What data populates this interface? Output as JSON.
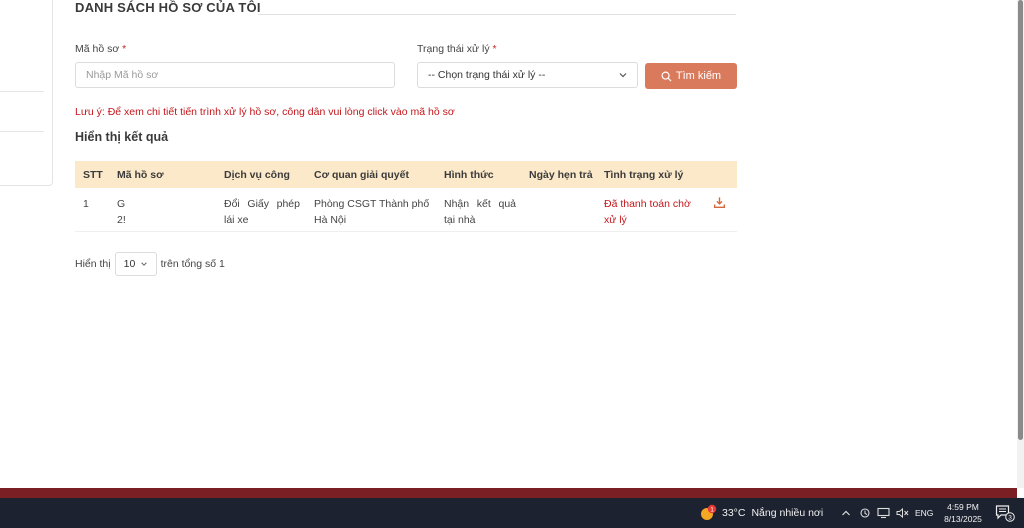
{
  "page": {
    "section_title": "DANH SÁCH HỒ SƠ CỦA TÔI",
    "note": "Lưu ý: Để xem chi tiết tiến trình xử lý hồ sơ, công dân vui lòng click vào mã hồ sơ",
    "results_title": "Hiển thị kết quả"
  },
  "search": {
    "code_label": "Mã hồ sơ",
    "code_placeholder": "Nhập Mã hồ sơ",
    "code_value": "",
    "status_label": "Trạng thái xử lý",
    "status_selected": "-- Chọn trạng thái xử lý --",
    "required_mark": "*",
    "button_label": "Tìm kiếm"
  },
  "table": {
    "columns": [
      "STT",
      "Mã hồ sơ",
      "Dịch vụ công",
      "Cơ quan giải quyết",
      "Hình thức",
      "Ngày hẹn trả",
      "Tình trạng xử lý"
    ],
    "rows": [
      {
        "stt": "1",
        "code_line1": "G",
        "code_line2": "2!",
        "service": "Đổi Giấy phép lái xe",
        "agency": "Phòng CSGT Thành phố Hà Nội",
        "form": "Nhận kết quả tại nhà",
        "due_date": "",
        "status": "Đã thanh toán chờ xử lý",
        "action_icon": "download-icon"
      }
    ]
  },
  "pager": {
    "prefix": "Hiển thị",
    "page_size": "10",
    "suffix": "trên tổng số 1"
  },
  "taskbar": {
    "weather_badge": "1",
    "temperature": "33°C",
    "weather_text": "Nắng nhiều nơi",
    "language": "ENG",
    "time": "4:59 PM",
    "date": "8/13/2025",
    "notification_count": "3"
  },
  "colors": {
    "accent_button": "#d97a5c",
    "table_header": "#fbe9c9",
    "note_red": "#c4161c",
    "footer_strip": "#7a1f24",
    "taskbar": "#1c2230"
  }
}
